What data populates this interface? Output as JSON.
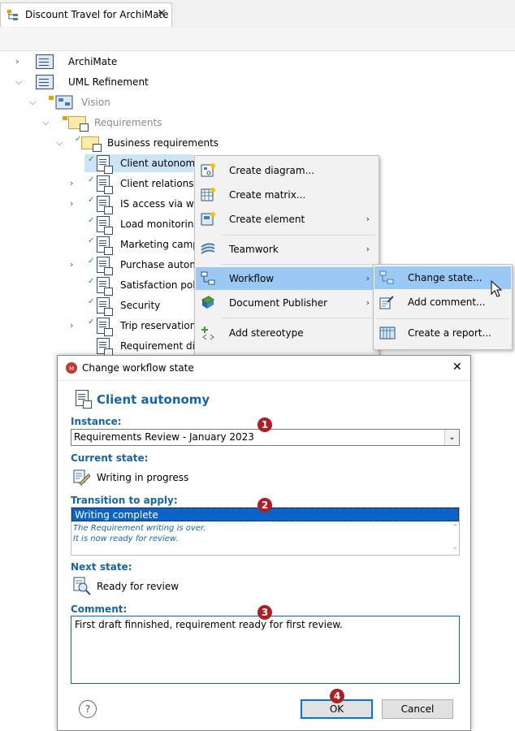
{
  "tab": {
    "title": "Discount Travel for ArchiMate",
    "close": "✕"
  },
  "tree": [
    {
      "label": "ArchiMate"
    },
    {
      "label": "UML Refinement"
    },
    {
      "label": "Vision"
    },
    {
      "label": "Requirements"
    },
    {
      "label": "Business requirements"
    },
    {
      "label": "Client autonomy"
    },
    {
      "label": "Client relationshi"
    },
    {
      "label": "IS access via web"
    },
    {
      "label": "Load monitoring"
    },
    {
      "label": "Marketing campa"
    },
    {
      "label": "Purchase automa"
    },
    {
      "label": "Satisfaction poll r"
    },
    {
      "label": "Security"
    },
    {
      "label": "Trip reservation p"
    },
    {
      "label": "Requirement diag"
    }
  ],
  "context_menu": {
    "items": [
      {
        "label": "Create diagram...",
        "icon": "create-diagram-icon"
      },
      {
        "label": "Create matrix...",
        "icon": "create-matrix-icon"
      },
      {
        "label": "Create element",
        "icon": "create-element-icon"
      },
      {
        "label": "Teamwork",
        "icon": "teamwork-icon"
      },
      {
        "label": "Workflow",
        "icon": "workflow-icon"
      },
      {
        "label": "Document Publisher",
        "icon": "document-publisher-icon"
      },
      {
        "label": "Add stereotype",
        "icon": "add-stereotype-icon"
      }
    ],
    "arrow": "›"
  },
  "submenu": {
    "items": [
      {
        "label": "Change state...",
        "icon": "change-state-icon"
      },
      {
        "label": "Add comment...",
        "icon": "add-comment-icon"
      },
      {
        "label": "Create a report...",
        "icon": "create-report-icon"
      }
    ]
  },
  "dialog": {
    "title": "Change workflow state",
    "element_name": "Client autonomy",
    "instance_label": "Instance:",
    "instance_value": "Requirements Review - January 2023",
    "current_state_label": "Current state:",
    "current_state_value": "Writing in progress",
    "transition_label": "Transition to apply:",
    "transition_value": "Writing complete",
    "transition_desc_1": "The Requirement writing is over.",
    "transition_desc_2": "It is now ready for review.",
    "next_state_label": "Next state:",
    "next_state_value": "Ready for review",
    "comment_label": "Comment:",
    "comment_value": "First draft finnished, requirement ready for first review.",
    "help": "?",
    "ok_label": "OK",
    "cancel_label": "Cancel",
    "close": "✕"
  },
  "badges": [
    "1",
    "2",
    "3",
    "4"
  ],
  "colors": {
    "accent_blue": "#1565a9",
    "selection": "#0a64c8",
    "highlight": "#99c9f4",
    "badge": "#b01e23"
  }
}
